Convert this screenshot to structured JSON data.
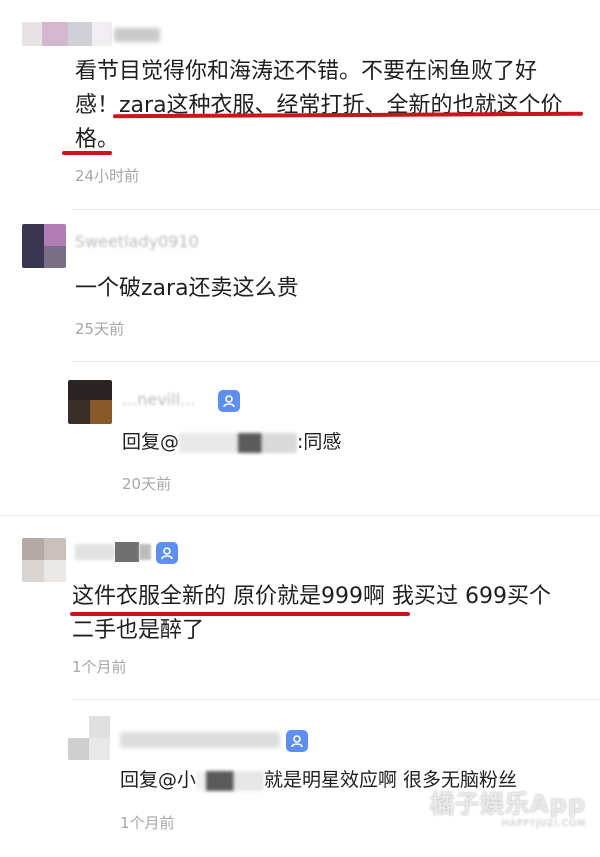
{
  "comments": [
    {
      "text": "看节目觉得你和海涛还不错。不要在闲鱼败了好感！zara这种衣服、经常打折、全新的也就这个价格。",
      "line1": "看节目觉得你和海涛还不错。不要在闲鱼败了好",
      "line2": "感！zara这种衣服、经常打折、全新的也就这个价",
      "line3": "格。",
      "time": "24小时前"
    },
    {
      "username": "Sweetlady0910",
      "text": "一个破zara还卖这么贵",
      "time": "25天前",
      "reply": {
        "username": "...nevill...",
        "prefix": "回复@",
        "suffix": ":同感",
        "time": "20天前"
      }
    },
    {
      "text": "这件衣服全新的 原价就是999啊 我买过 699买个二手也是醉了",
      "line1_part1": "这件衣服全新的 原价就是999啊",
      "line1_part2": " 我买过 699买个",
      "line2": "二手也是醉了",
      "time": "1个月前",
      "reply": {
        "prefix": "回复@小",
        "suffix": "就是明星效应啊 很多无脑粉丝",
        "time": "1个月前"
      }
    }
  ],
  "watermark": {
    "main": "橘子娱乐App",
    "sub": "HAPPYJUZI.COM"
  },
  "colors": {
    "underline": "#c8161d",
    "verified_badge": "#5d8ff0",
    "time_gray": "#a6a6a6"
  },
  "icons": [
    "verified-user-icon"
  ]
}
